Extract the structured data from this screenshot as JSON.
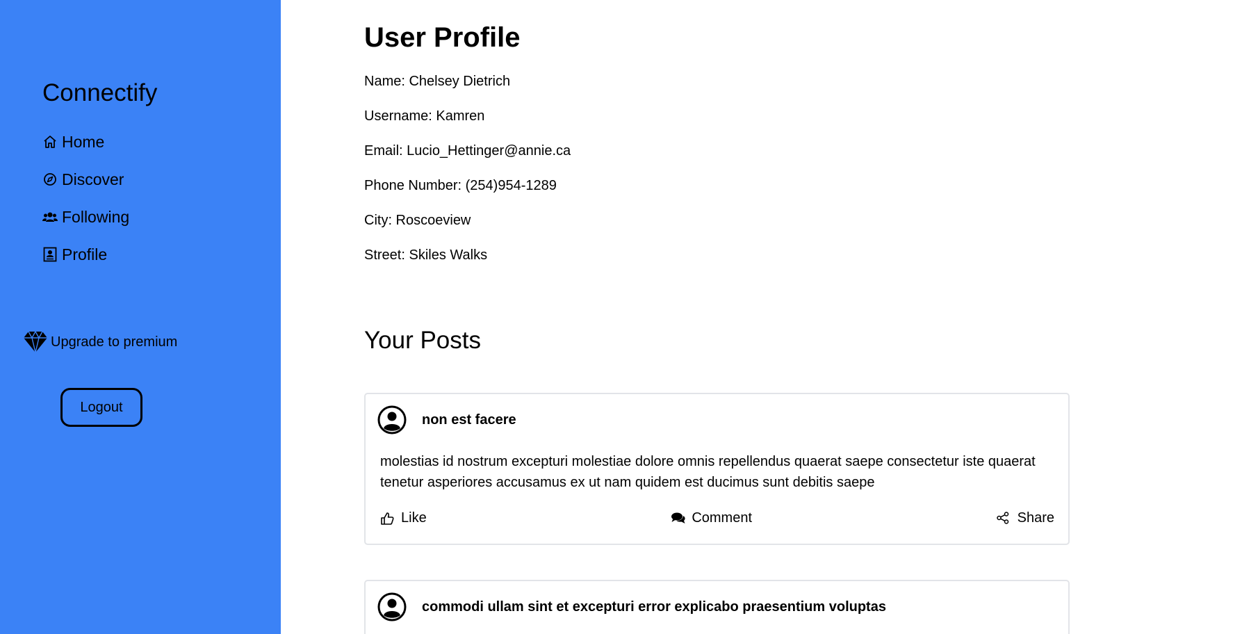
{
  "sidebar": {
    "brand": "Connectify",
    "nav": [
      {
        "label": "Home",
        "icon": "home-icon"
      },
      {
        "label": "Discover",
        "icon": "compass-icon"
      },
      {
        "label": "Following",
        "icon": "users-icon"
      },
      {
        "label": "Profile",
        "icon": "profile-card-icon"
      }
    ],
    "premium_label": "Upgrade to premium",
    "premium_icon": "diamond-icon",
    "logout_label": "Logout",
    "background_color": "#3b82f6"
  },
  "profile": {
    "title": "User Profile",
    "name": "Name: Chelsey Dietrich",
    "username": "Username: Kamren",
    "email": "Email: Lucio_Hettinger@annie.ca",
    "phone": "Phone Number: (254)954-1289",
    "city": "City: Roscoeview",
    "street": "Street: Skiles Walks"
  },
  "posts_section": {
    "title": "Your Posts",
    "posts": [
      {
        "title": "non est facere",
        "body": "molestias id nostrum excepturi molestiae dolore omnis repellendus quaerat saepe consectetur iste quaerat tenetur asperiores accusamus ex ut nam quidem est ducimus sunt debitis saepe",
        "like_label": "Like",
        "comment_label": "Comment",
        "share_label": "Share"
      },
      {
        "title": "commodi ullam sint et excepturi error explicabo praesentium voluptas"
      }
    ]
  }
}
